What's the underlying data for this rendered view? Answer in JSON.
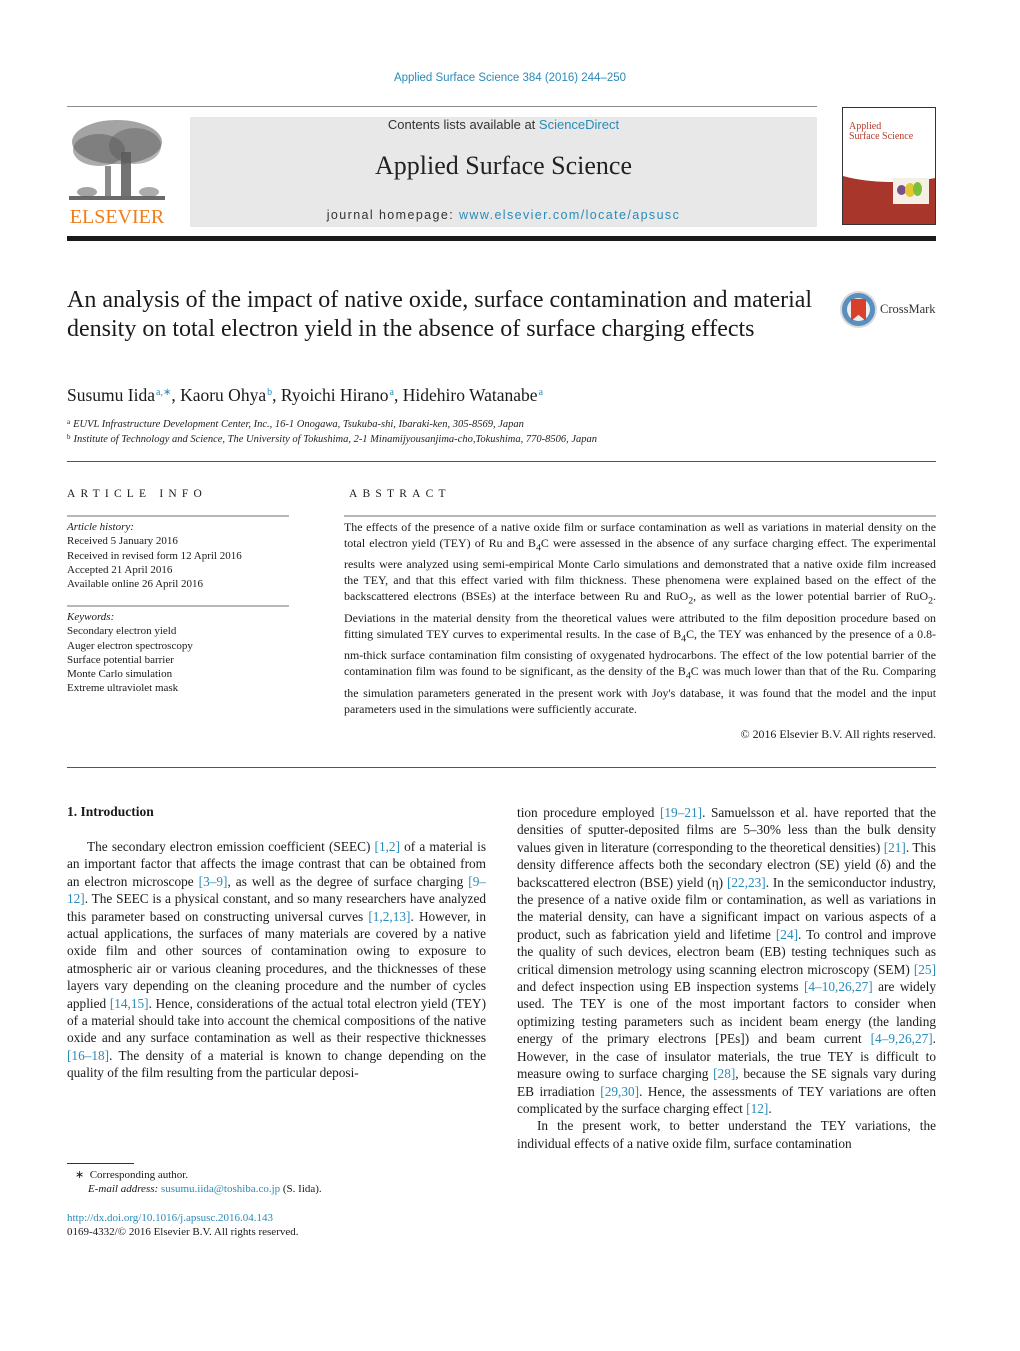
{
  "header": {
    "citation": "Applied Surface Science 384 (2016) 244–250",
    "contents_prefix": "Contents lists available at ",
    "contents_link": "ScienceDirect",
    "journal_title": "Applied Surface Science",
    "homepage_prefix": "journal homepage: ",
    "homepage_link": "www.elsevier.com/locate/apsusc",
    "publisher_logo": "ELSEVIER",
    "cover_title_line1": "Applied",
    "cover_title_line2": "Surface Science",
    "crossmark_label": "CrossMark"
  },
  "article": {
    "title": "An analysis of the impact of native oxide, surface contamination and material density on total electron yield in the absence of surface charging effects",
    "authors": [
      {
        "name": "Susumu Iida",
        "sup": "a,∗"
      },
      {
        "name": "Kaoru Ohya",
        "sup": "b"
      },
      {
        "name": "Ryoichi Hirano",
        "sup": "a"
      },
      {
        "name": "Hidehiro Watanabe",
        "sup": "a"
      }
    ],
    "affiliations": [
      {
        "mark": "a",
        "text": "EUVL Infrastructure Development Center, Inc., 16-1 Onogawa, Tsukuba-shi, Ibaraki-ken, 305-8569, Japan"
      },
      {
        "mark": "b",
        "text": "Institute of Technology and Science, The University of Tokushima, 2-1 Minamijyousanjima-cho,Tokushima, 770-8506, Japan"
      }
    ]
  },
  "article_info": {
    "heading": "ARTICLE INFO",
    "history_label": "Article history:",
    "history": [
      "Received 5 January 2016",
      "Received in revised form 12 April 2016",
      "Accepted 21 April 2016",
      "Available online 26 April 2016"
    ],
    "keywords_label": "Keywords:",
    "keywords": [
      "Secondary electron yield",
      "Auger electron spectroscopy",
      "Surface potential barrier",
      "Monte Carlo simulation",
      "Extreme ultraviolet mask"
    ]
  },
  "abstract": {
    "heading": "ABSTRACT",
    "segments": [
      "The effects of the presence of a native oxide film or surface contamination as well as variations in material density on the total electron yield (TEY) of Ru and B",
      "4",
      "C were assessed in the absence of any surface charging effect. The experimental results were analyzed using semi-empirical Monte Carlo simulations and demonstrated that a native oxide film increased the TEY, and that this effect varied with film thickness. These phenomena were explained based on the effect of the backscattered electrons (BSEs) at the interface between Ru and RuO",
      "2",
      ", as well as the lower potential barrier of RuO",
      "2",
      ". Deviations in the material density from the theoretical values were attributed to the film deposition procedure based on fitting simulated TEY curves to experimental results. In the case of B",
      "4",
      "C, the TEY was enhanced by the presence of a 0.8-nm-thick surface contamination film consisting of oxygenated hydrocarbons. The effect of the low potential barrier of the contamination film was found to be significant, as the density of the B",
      "4",
      "C was much lower than that of the Ru. Comparing the simulation parameters generated in the present work with Joy's database, it was found that the model and the input parameters used in the simulations were sufficiently accurate."
    ],
    "copyright": "© 2016 Elsevier B.V. All rights reserved."
  },
  "introduction": {
    "title": "1.  Introduction",
    "left_p1": [
      {
        "t": "The secondary electron emission coefficient (SEEC) "
      },
      {
        "ref": "[1,2]"
      },
      {
        "t": " of a material is an important factor that affects the image contrast that can be obtained from an electron microscope "
      },
      {
        "ref": "[3–9]"
      },
      {
        "t": ", as well as the degree of surface charging "
      },
      {
        "ref": "[9–12]"
      },
      {
        "t": ". The SEEC is a physical constant, and so many researchers have analyzed this parameter based on constructing universal curves "
      },
      {
        "ref": "[1,2,13]"
      },
      {
        "t": ". However, in actual applications, the surfaces of many materials are covered by a native oxide film and other sources of contamination owing to exposure to atmospheric air or various cleaning procedures, and the thicknesses of these layers vary depending on the cleaning procedure and the number of cycles applied "
      },
      {
        "ref": "[14,15]"
      },
      {
        "t": ". Hence, considerations of the actual total electron yield (TEY) of a material should take into account the chemical compositions of the native oxide and any surface contamination as well as their respective thicknesses "
      },
      {
        "ref": "[16–18]"
      },
      {
        "t": ". The density of a material is known to change depending on the quality of the film resulting from the particular deposi-"
      }
    ],
    "right_p1": [
      {
        "t": "tion procedure employed "
      },
      {
        "ref": "[19–21]"
      },
      {
        "t": ". Samuelsson et al. have reported that the densities of sputter-deposited films are 5–30% less than the bulk density values given in literature (corresponding to the theoretical densities) "
      },
      {
        "ref": "[21]"
      },
      {
        "t": ". This density difference affects both the secondary electron (SE) yield (δ) and the backscattered electron (BSE) yield (η) "
      },
      {
        "ref": "[22,23]"
      },
      {
        "t": ". In the semiconductor industry, the presence of a native oxide film or contamination, as well as variations in the material density, can have a significant impact on various aspects of a product, such as fabrication yield and lifetime "
      },
      {
        "ref": "[24]"
      },
      {
        "t": ". To control and improve the quality of such devices, electron beam (EB) testing techniques such as critical dimension metrology using scanning electron microscopy (SEM) "
      },
      {
        "ref": "[25]"
      },
      {
        "t": " and defect inspection using EB inspection systems "
      },
      {
        "ref": "[4–10,26,27]"
      },
      {
        "t": " are widely used. The TEY is one of the most important factors to consider when optimizing testing parameters such as incident beam energy (the landing energy of the primary electrons [PEs]) and beam current "
      },
      {
        "ref": "[4–9,26,27]"
      },
      {
        "t": ". However, in the case of insulator materials, the true TEY is difficult to measure owing to surface charging "
      },
      {
        "ref": "[28]"
      },
      {
        "t": ", because the SE signals vary during EB irradiation "
      },
      {
        "ref": "[29,30]"
      },
      {
        "t": ". Hence, the assessments of TEY variations are often complicated by the surface charging effect "
      },
      {
        "ref": "[12]"
      },
      {
        "t": "."
      }
    ],
    "right_p2": [
      {
        "t": "In the present work, to better understand the TEY variations, the individual effects of a native oxide film, surface contamination"
      }
    ]
  },
  "footnotes": {
    "corresponding_mark": "∗",
    "corresponding": "Corresponding author.",
    "email_label": "E-mail address: ",
    "email": "susumu.iida@toshiba.co.jp",
    "email_suffix": " (S. Iida).",
    "doi": "http://dx.doi.org/10.1016/j.apsusc.2016.04.143",
    "issn": "0169-4332/© 2016 Elsevier B.V. All rights reserved."
  },
  "colors": {
    "link": "#2a8ab8",
    "elsevier_orange": "#f07d1a",
    "cover_red": "#a8362b",
    "masthead_gray": "#e8e8e8"
  }
}
